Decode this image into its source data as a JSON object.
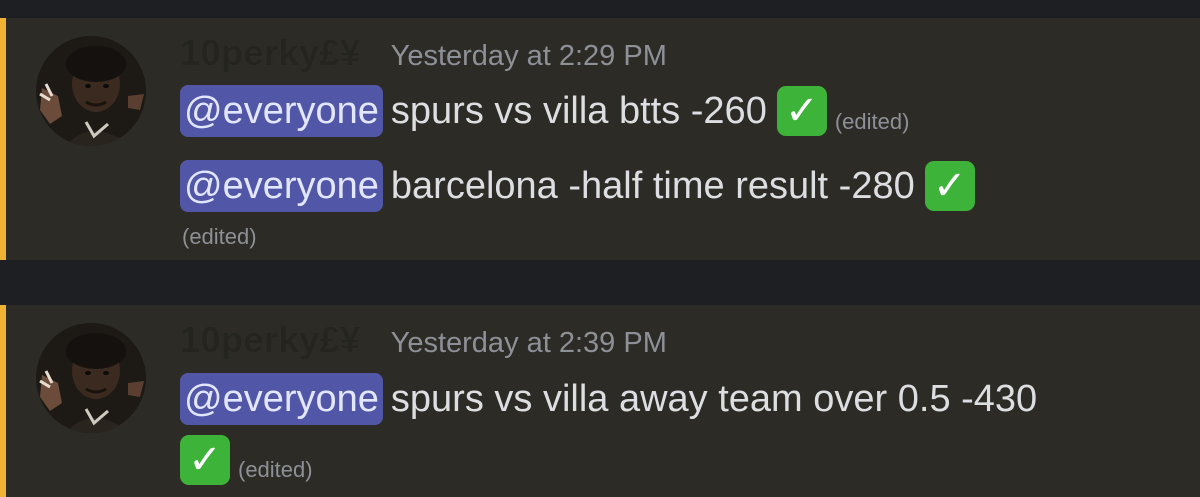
{
  "messages": [
    {
      "username": "10perky£¥",
      "timestamp": "Yesterday at 2:29 PM",
      "lines": [
        {
          "mention": "@everyone",
          "text": "spurs vs villa btts -260",
          "check": "✓",
          "edited": "(edited)"
        },
        {
          "mention": "@everyone",
          "text": "barcelona -half time result -280",
          "check": "✓",
          "edited": "(edited)"
        }
      ]
    },
    {
      "username": "10perky£¥",
      "timestamp": "Yesterday at 2:39 PM",
      "lines": [
        {
          "mention": "@everyone",
          "text": "spurs vs villa away team over 0.5 -430",
          "check": "✓",
          "edited": "(edited)"
        }
      ]
    }
  ],
  "colors": {
    "accent_bar": "#f0b232",
    "mention_bg": "#5157a6",
    "check_bg": "#3eb33a",
    "message_bg": "#2c2b25"
  },
  "icons": {
    "check": "white-heavy-check-mark-icon"
  }
}
